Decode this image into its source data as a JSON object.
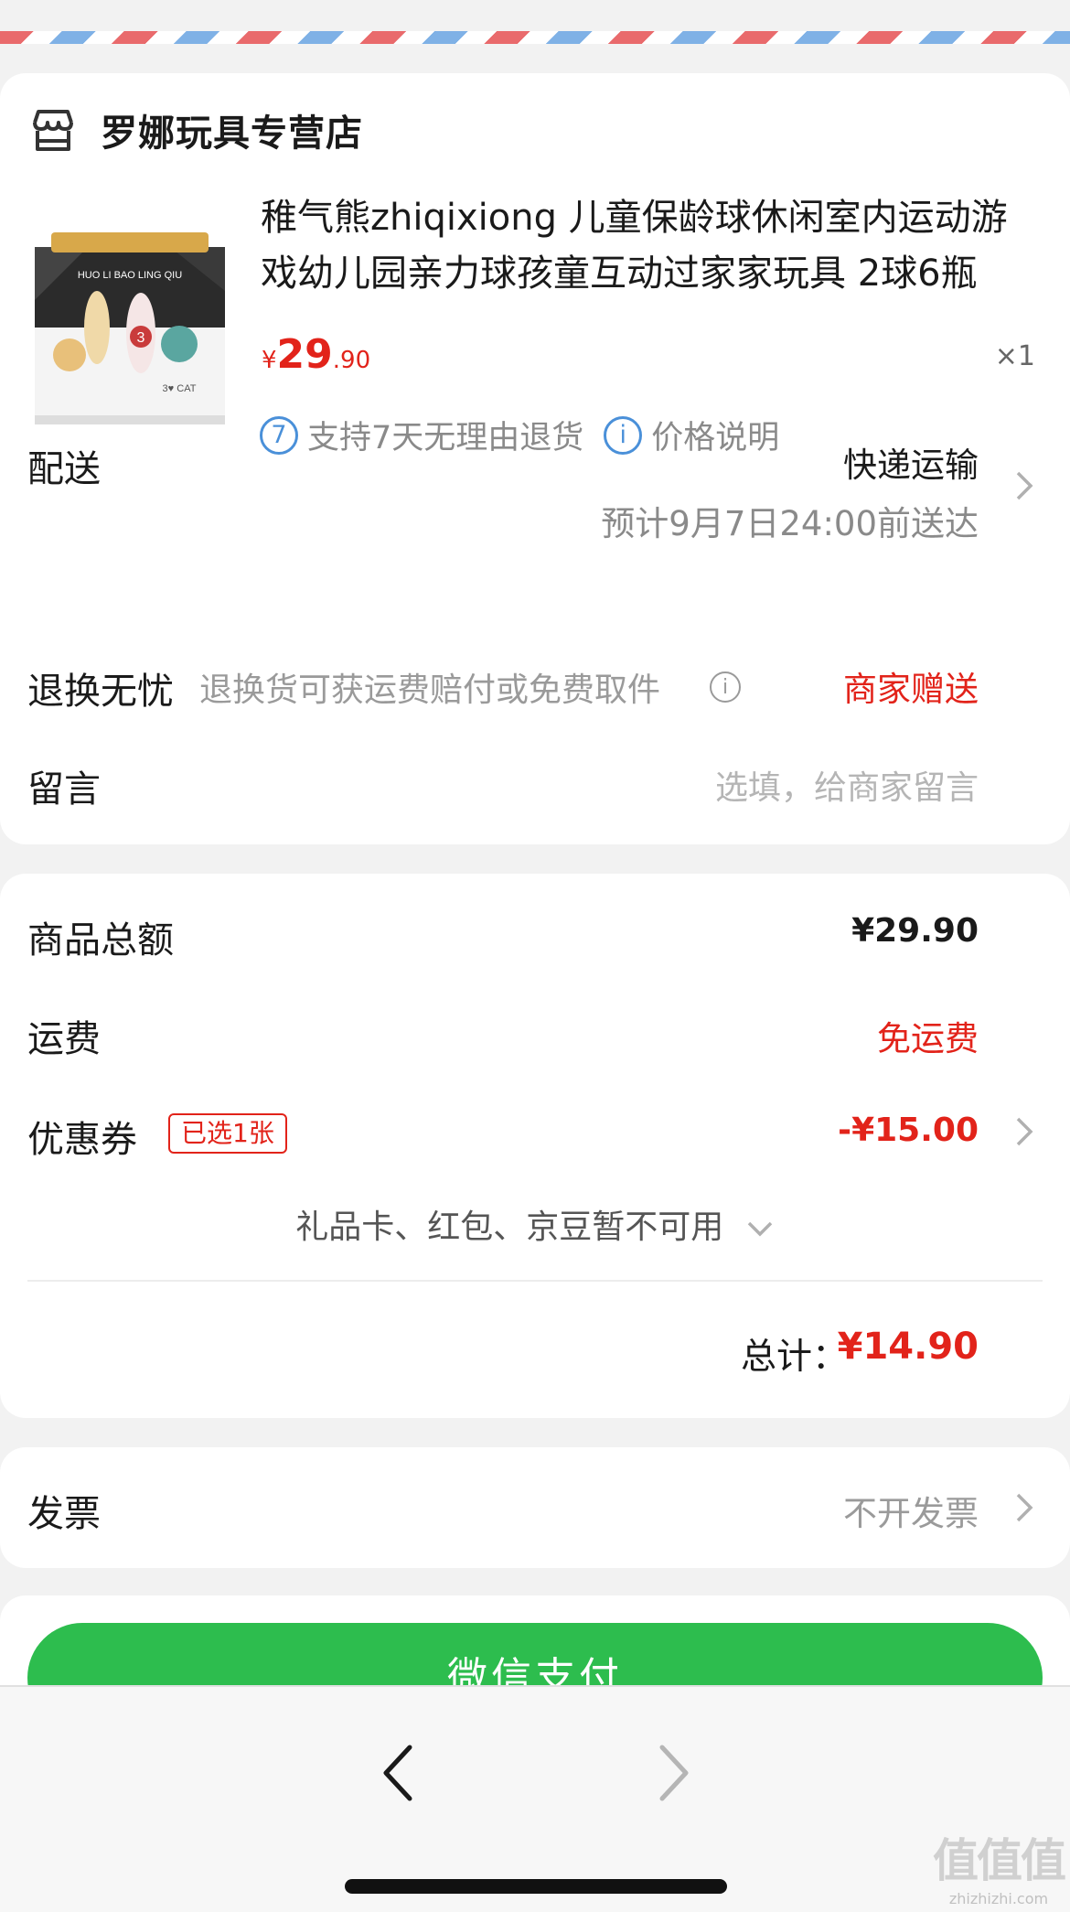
{
  "store": {
    "name": "罗娜玩具专营店"
  },
  "product": {
    "title": "稚气熊zhiqixiong 儿童保龄球休闲室内运动游戏幼儿园亲力球孩童互动过家家玩具 2球6瓶",
    "price_currency": "¥",
    "price_int": "29",
    "price_dec": ".90",
    "quantity": "×1",
    "image_text": "HUO LI BAO LING QIU",
    "tags": [
      {
        "icon": "7",
        "label": "支持7天无理由退货"
      },
      {
        "icon": "i",
        "label": "价格说明"
      }
    ]
  },
  "delivery": {
    "label": "配送",
    "method": "快递运输",
    "eta": "预计9月7日24:00前送达"
  },
  "returns": {
    "label": "退换无忧",
    "desc": "退换货可获运费赔付或免费取件",
    "info_icon": "i",
    "value": "商家赠送"
  },
  "message": {
    "label": "留言",
    "placeholder": "选填，给商家留言"
  },
  "amounts": {
    "goods_total_label": "商品总额",
    "goods_total_value": "¥29.90",
    "shipping_label": "运费",
    "shipping_value": "免运费",
    "coupon_label": "优惠券",
    "coupon_badge": "已选1张",
    "coupon_value": "-¥15.00",
    "giftcards_note": "礼品卡、红包、京豆暂不可用",
    "total_label": "总计：",
    "total_value": "¥14.90"
  },
  "invoice": {
    "label": "发票",
    "value": "不开发票"
  },
  "pay": {
    "button_label": "微信支付"
  },
  "watermark": {
    "big": "值值值",
    "small": "zhizhizhi.com"
  },
  "colors": {
    "accent_red": "#e2231a",
    "wechat_green": "#2dbd4e",
    "info_blue": "#4a90d9"
  },
  "icons": [
    "store-icon",
    "chevron-right-icon",
    "chevron-down-icon",
    "info-icon",
    "back-arrow-icon",
    "forward-arrow-icon"
  ]
}
